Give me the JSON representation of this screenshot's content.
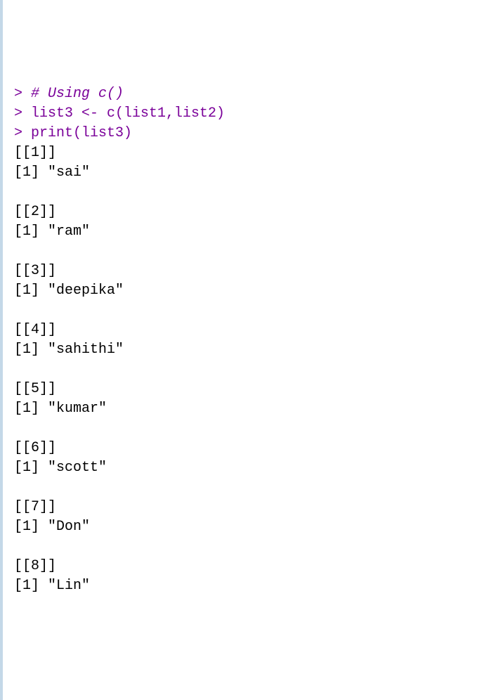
{
  "input": {
    "line1_prompt": "> ",
    "line1_text": "# Using c()",
    "line2_prompt": "> ",
    "line2_text": "list3 <- c(list1,list2)",
    "line3_prompt": "> ",
    "line3_text": "print(list3)"
  },
  "output": {
    "items": [
      {
        "index": "[[1]]",
        "value": "[1] \"sai\""
      },
      {
        "index": "[[2]]",
        "value": "[1] \"ram\""
      },
      {
        "index": "[[3]]",
        "value": "[1] \"deepika\""
      },
      {
        "index": "[[4]]",
        "value": "[1] \"sahithi\""
      },
      {
        "index": "[[5]]",
        "value": "[1] \"kumar\""
      },
      {
        "index": "[[6]]",
        "value": "[1] \"scott\""
      },
      {
        "index": "[[7]]",
        "value": "[1] \"Don\""
      },
      {
        "index": "[[8]]",
        "value": "[1] \"Lin\""
      }
    ]
  }
}
